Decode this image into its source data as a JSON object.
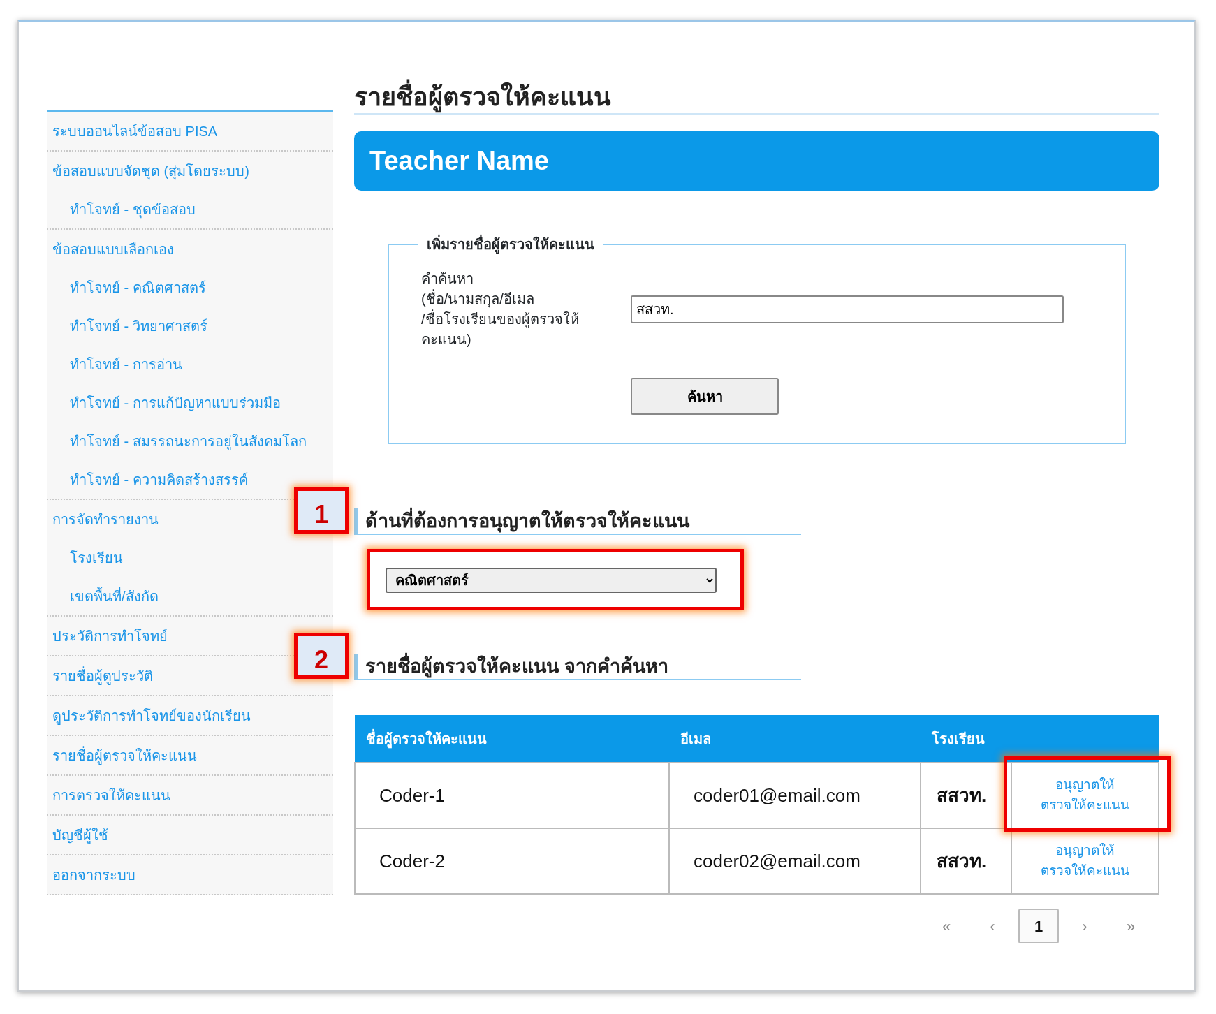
{
  "sidebar": {
    "items": [
      {
        "label": "ระบบออนไลน์ข้อสอบ PISA"
      },
      {
        "label": "ข้อสอบแบบจัดชุด (สุ่มโดยระบบ)",
        "children": [
          {
            "label": "ทำโจทย์ - ชุดข้อสอบ"
          }
        ]
      },
      {
        "label": "ข้อสอบแบบเลือกเอง",
        "children": [
          {
            "label": "ทำโจทย์ - คณิตศาสตร์"
          },
          {
            "label": "ทำโจทย์ - วิทยาศาสตร์"
          },
          {
            "label": "ทำโจทย์ - การอ่าน"
          },
          {
            "label": "ทำโจทย์ - การแก้ปัญหาแบบร่วมมือ"
          },
          {
            "label": "ทำโจทย์ - สมรรถนะการอยู่ในสังคมโลก"
          },
          {
            "label": "ทำโจทย์ - ความคิดสร้างสรรค์"
          }
        ]
      },
      {
        "label": "การจัดทำรายงาน",
        "children": [
          {
            "label": "โรงเรียน"
          },
          {
            "label": "เขตพื้นที่/สังกัด"
          }
        ]
      },
      {
        "label": "ประวัติการทำโจทย์"
      },
      {
        "label": "รายชื่อผู้ดูประวัติ"
      },
      {
        "label": "ดูประวัติการทำโจทย์ของนักเรียน"
      },
      {
        "label": "รายชื่อผู้ตรวจให้คะแนน"
      },
      {
        "label": "การตรวจให้คะแนน"
      },
      {
        "label": "บัญชีผู้ใช้"
      },
      {
        "label": "ออกจากระบบ"
      }
    ]
  },
  "page_title": "รายชื่อผู้ตรวจให้คะแนน",
  "banner": "Teacher Name",
  "search_form": {
    "legend": "เพิ่มรายชื่อผู้ตรวจให้คะแนน",
    "label": "คำค้นหา\n(ชื่อ/นามสกุล/อีเมล\n/ชื่อโรงเรียนของผู้ตรวจให้\nคะแนน)",
    "value": "สสวท.",
    "button": "ค้นหา"
  },
  "subject_section": {
    "heading": "ด้านที่ต้องการอนุญาตให้ตรวจให้คะแนน",
    "marker": "1",
    "select": {
      "value": "คณิตศาสตร์",
      "highlighted": true
    }
  },
  "results_section": {
    "heading": "รายชื่อผู้ตรวจให้คะแนน จากคำค้นหา",
    "marker": "2"
  },
  "table": {
    "columns": [
      "ชื่อผู้ตรวจให้คะแนน",
      "อีเมล",
      "โรงเรียน"
    ],
    "rows": [
      {
        "name": "Coder-1",
        "email": "coder01@email.com",
        "school": "สสวท.",
        "action": "อนุญาตให้\nตรวจให้คะแนน",
        "highlighted": true
      },
      {
        "name": "Coder-2",
        "email": "coder02@email.com",
        "school": "สสวท.",
        "action": "อนุญาตให้\nตรวจให้คะแนน",
        "highlighted": false
      }
    ]
  },
  "pagination": [
    {
      "label": "«",
      "selected": false
    },
    {
      "label": "‹",
      "selected": false
    },
    {
      "label": "1",
      "selected": true
    },
    {
      "label": "›",
      "selected": false
    },
    {
      "label": "»",
      "selected": false
    }
  ]
}
